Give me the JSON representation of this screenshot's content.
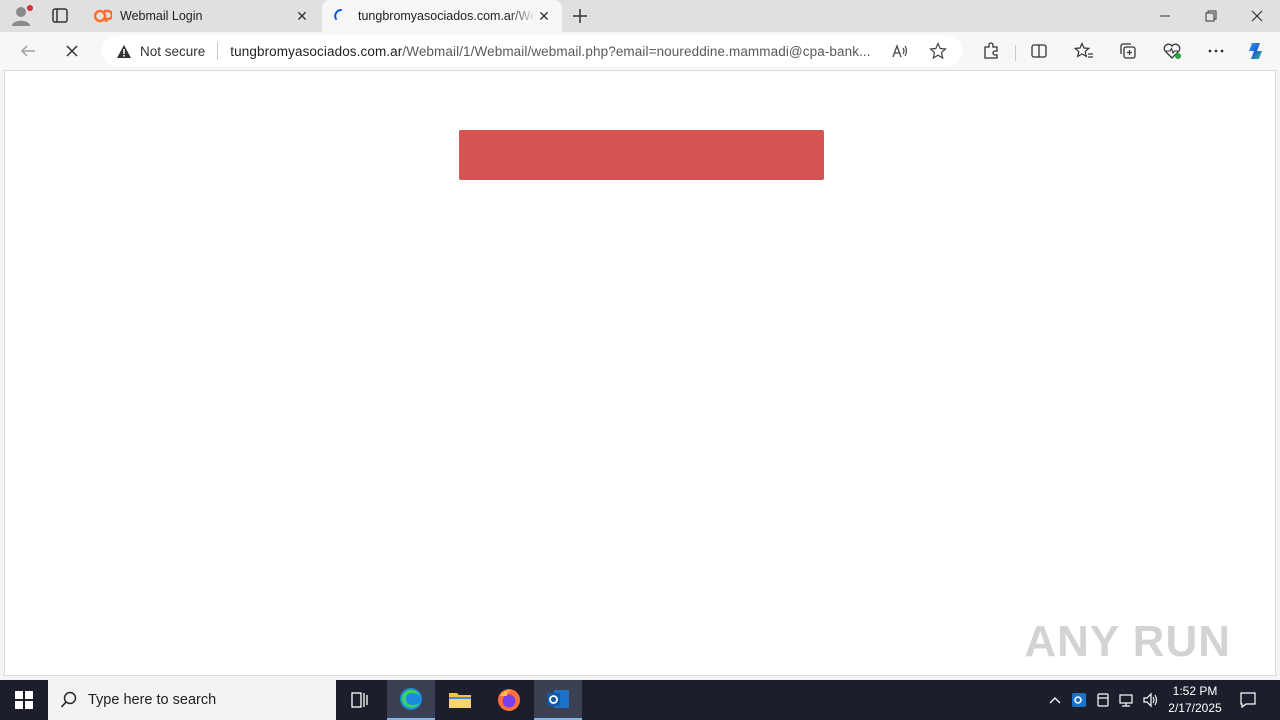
{
  "browser": {
    "tabs": [
      {
        "title": "Webmail Login",
        "favicon": "cpanel-logo-icon",
        "active": false
      },
      {
        "title": "tungbromyasociados.com.ar/Webmail/1/Webmail/webmail.php",
        "favicon": "loading-icon",
        "active": true
      }
    ],
    "security_label": "Not secure",
    "url_host": "tungbromyasociados.com.ar",
    "url_path": "/Webmail/1/Webmail/webmail.php?email=noureddine.mammadi@cpa-bank...",
    "loading": true
  },
  "page": {
    "banner_color": "#d55350",
    "watermark_text": "ANY RUN"
  },
  "taskbar": {
    "search_placeholder": "Type here to search",
    "time": "1:52 PM",
    "date": "2/17/2025"
  },
  "colors": {
    "tabbar": "#e0e0e0",
    "toolbar": "#f7f7f7",
    "taskbar": "#1c1f2b",
    "accent": "#0078d4"
  }
}
